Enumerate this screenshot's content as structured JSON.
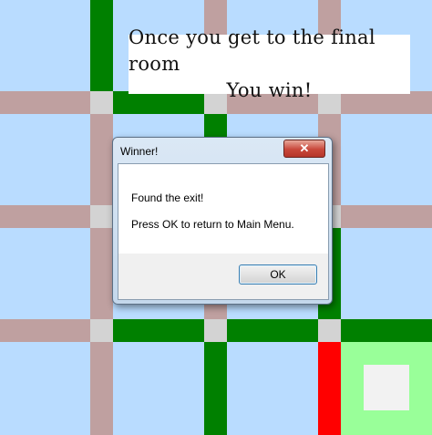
{
  "banner": {
    "line1": "Once you get to the final room",
    "line2": "You win!"
  },
  "dialog": {
    "title": "Winner!",
    "close_label": "✕",
    "message_line1": "Found the exit!",
    "message_line2": "Press OK to return to Main Menu.",
    "ok_label": "OK"
  },
  "colors": {
    "room": "#b9dcff",
    "open_passage": "#bfa0a0",
    "wall": "#008000",
    "node": "#d3d3d3",
    "exit_room": "#99ff99",
    "locked_door": "#ff0000",
    "player": "#f2f2f2"
  }
}
